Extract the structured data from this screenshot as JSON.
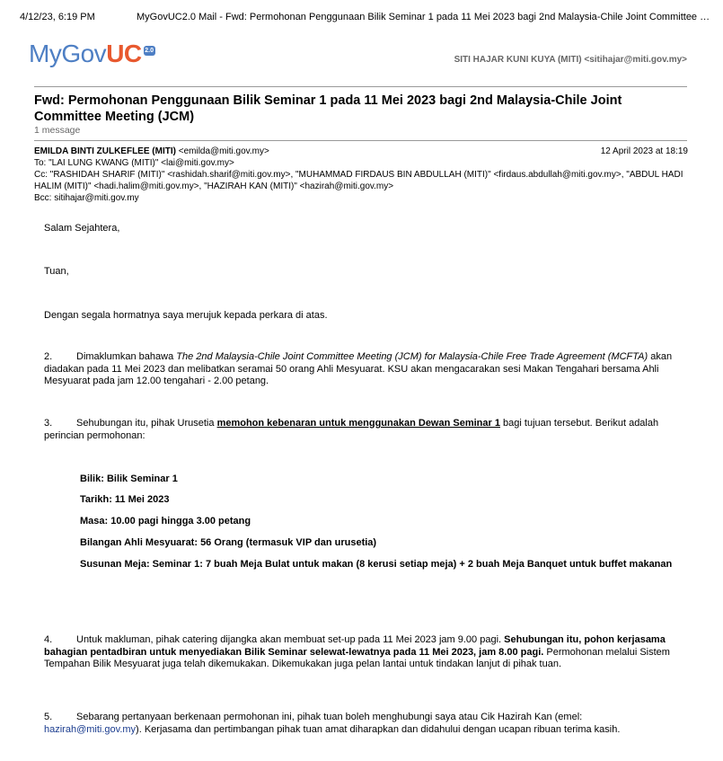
{
  "browser": {
    "print_date": "4/12/23, 6:19 PM",
    "print_title": "MyGovUC2.0 Mail - Fwd: Permohonan Penggunaan Bilik Seminar 1 pada 11 Mei 2023 bagi 2nd Malaysia-Chile Joint Committee …"
  },
  "logo": {
    "part1": "MyGov",
    "part2": "UC",
    "badge": "2.0"
  },
  "account": {
    "user": "SITI HAJAR KUNI KUYA (MITI) <sitihajar@miti.gov.my>"
  },
  "thread": {
    "subject": "Fwd: Permohonan Penggunaan Bilik Seminar 1 pada 11 Mei 2023 bagi 2nd Malaysia-Chile Joint Committee Meeting (JCM)",
    "count": "1 message"
  },
  "message": {
    "from_name": "EMILDA BINTI ZULKEFLEE (MITI)",
    "from_email": "<emilda@miti.gov.my>",
    "date": "12 April 2023 at 18:19",
    "to": "To: \"LAI LUNG KWANG (MITI)\" <lai@miti.gov.my>",
    "cc": "Cc: \"RASHIDAH SHARIF (MITI)\" <rashidah.sharif@miti.gov.my>, \"MUHAMMAD FIRDAUS BIN ABDULLAH (MITI)\" <firdaus.abdullah@miti.gov.my>, \"ABDUL HADI HALIM (MITI)\" <hadi.halim@miti.gov.my>, \"HAZIRAH KAN (MITI)\" <hazirah@miti.gov.my>",
    "bcc": "Bcc: sitihajar@miti.gov.my",
    "greeting": "Salam Sejahtera,",
    "salutation": "Tuan,",
    "intro": "Dengan segala hormatnya saya merujuk kepada perkara di atas.",
    "p2_num": "2.",
    "p2_a": "Dimaklumkan bahawa ",
    "p2_italic": "The 2nd Malaysia-Chile Joint Committee Meeting (JCM) for Malaysia-Chile Free Trade Agreement (MCFTA)",
    "p2_b": " akan diadakan pada 11 Mei 2023 dan melibatkan seramai 50 orang Ahli Mesyuarat. KSU akan mengacarakan sesi Makan Tengahari bersama Ahli Mesyuarat pada jam 12.00 tengahari - 2.00 petang.",
    "p3_num": "3.",
    "p3_a": "Sehubungan itu, pihak Urusetia ",
    "p3_underline": "memohon kebenaran untuk menggunakan Dewan Seminar 1",
    "p3_b": " bagi tujuan tersebut. Berikut adalah perincian permohonan:",
    "details": [
      "Bilik: Bilik Seminar 1",
      "Tarikh: 11 Mei 2023",
      "Masa: 10.00 pagi hingga 3.00 petang",
      "Bilangan Ahli Mesyuarat: 56 Orang (termasuk VIP dan urusetia)"
    ],
    "susunan": "Susunan Meja: Seminar 1: 7 buah Meja Bulat untuk makan (8 kerusi setiap meja) + 2 buah Meja Banquet untuk buffet makanan",
    "p4_num": "4.",
    "p4_a": "Untuk makluman, pihak catering dijangka akan membuat set-up pada 11 Mei 2023 jam 9.00 pagi. ",
    "p4_bold": "Sehubungan itu, pohon kerjasama bahagian pentadbiran untuk menyediakan Bilik Seminar selewat-lewatnya pada 11 Mei 2023, jam 8.00 pagi.",
    "p4_b": " Permohonan melalui Sistem Tempahan Bilik Mesyuarat juga telah dikemukakan. Dikemukakan juga pelan lantai untuk tindakan lanjut di pihak tuan.",
    "p5_num": "5.",
    "p5_a": "Sebarang pertanyaan berkenaan permohonan ini, pihak tuan boleh menghubungi saya atau Cik Hazirah Kan (emel: ",
    "p5_link": "hazirah@miti.gov.my",
    "p5_b": "). Kerjasama dan pertimbangan pihak tuan amat diharapkan dan didahului dengan ucapan ribuan terima kasih."
  }
}
